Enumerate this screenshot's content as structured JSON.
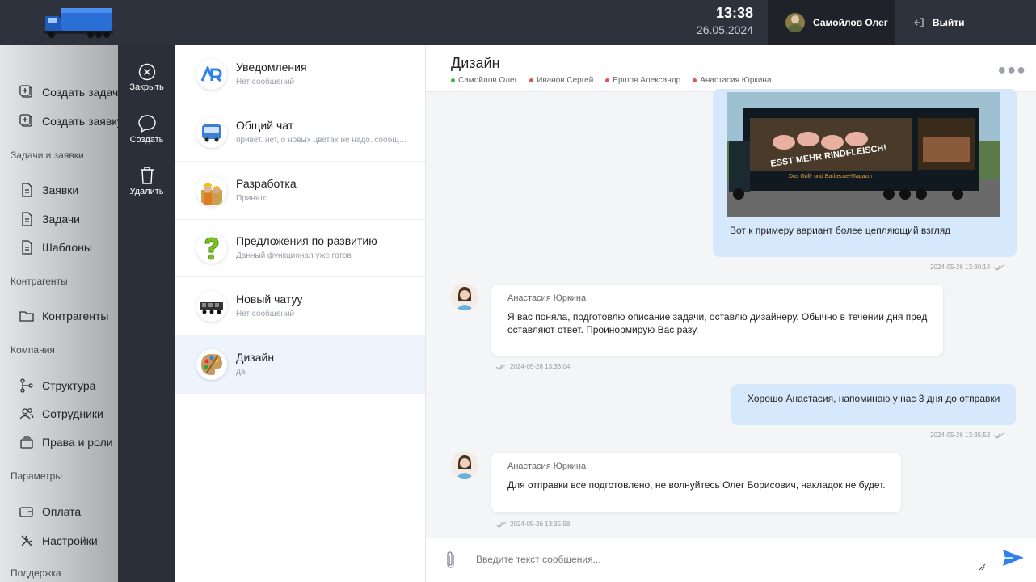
{
  "header": {
    "time": "13:38",
    "date": "26.05.2024",
    "user_name": "Самойлов Олег",
    "logout_label": "Выйти"
  },
  "leftnav": {
    "create_task": "Создать задачу",
    "create_request": "Создать заявку",
    "section_tasks": "Задачи и заявки",
    "requests": "Заявки",
    "tasks": "Задачи",
    "templates": "Шаблоны",
    "section_contractors": "Контрагенты",
    "contractors": "Контрагенты",
    "section_company": "Компания",
    "structure": "Структура",
    "employees": "Сотрудники",
    "rights": "Права и роли",
    "section_params": "Параметры",
    "payment": "Оплата",
    "settings": "Настройки",
    "section_support": "Поддержка"
  },
  "actions": {
    "close": "Закрыть",
    "create": "Создать",
    "delete": "Удалить"
  },
  "chats": [
    {
      "title": "Уведомления",
      "subtitle": "Нет сообщений"
    },
    {
      "title": "Общий чат",
      "subtitle": "привет. нет, о новых цветах не надо. сообщу позже"
    },
    {
      "title": "Разработка",
      "subtitle": "Принято"
    },
    {
      "title": "Предложения по развитию",
      "subtitle": "Данный функционал уже готов"
    },
    {
      "title": "Новый чатуу",
      "subtitle": "Нет сообщений"
    },
    {
      "title": "Дизайн",
      "subtitle": "да"
    }
  ],
  "conversation": {
    "title": "Дизайн",
    "participants": [
      {
        "name": "Самойлов Олег",
        "color": "#3cb44b"
      },
      {
        "name": "Иванов Сергей",
        "color": "#e05555"
      },
      {
        "name": "Ершов Александр",
        "color": "#e05555"
      },
      {
        "name": "Анастасия Юркина",
        "color": "#e05555"
      }
    ],
    "messages": [
      {
        "text": "Вот к примеру вариант более цепляющий взгляд",
        "time": "2024-05-26 13:30:14",
        "truck_slogan": "ESST MEHR RINDFLEISCH!",
        "truck_magazine": "Das Grill- und Barbecue-Magazin"
      },
      {
        "author": "Анастасия Юркина",
        "text": "Я вас поняла, подготовлю описание задачи, оставлю дизайнеру. Обычно в течении дня пред оставляют ответ. Проинормирую Вас разу.",
        "time": "2024-05-26 13:33:04"
      },
      {
        "text": "Хорошо Анастасия, напоминаю у нас 3 дня до отправки",
        "time": "2024-05-26 13:35:52"
      },
      {
        "author": "Анастасия Юркина",
        "text": "Для отправки все подготовлено, не волнуйтесь Олег Борисович, накладок не будет.",
        "time": "2024-05-26 13:35:58"
      }
    ],
    "input_placeholder": "Введите текст сообщения..."
  },
  "colors": {
    "header_bg": "#2e323c",
    "accent": "#2f80ed",
    "bubble_out": "#d6e8fb"
  }
}
